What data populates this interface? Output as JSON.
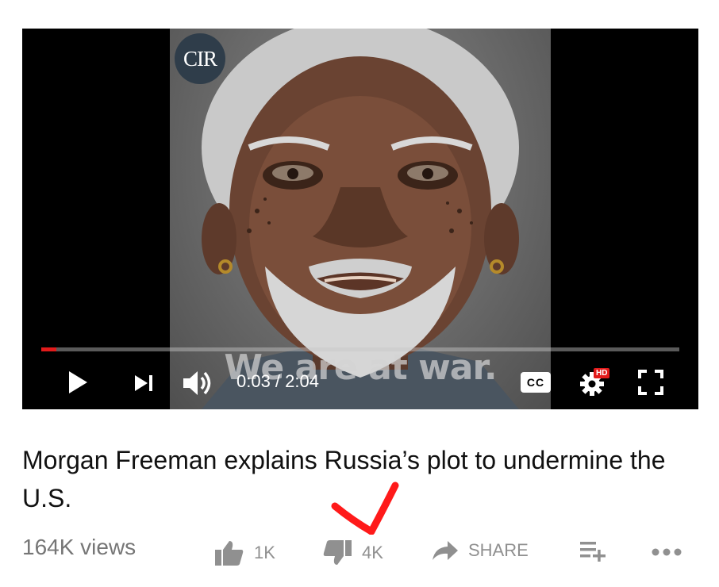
{
  "player": {
    "channel_logo": "CIR",
    "caption_overlay": "We are at war.",
    "current_time": "0:03",
    "duration": "2:04",
    "time_text": "0:03 / 2:04",
    "progress_fraction": 0.024,
    "cc_label": "CC",
    "hd_badge": "HD",
    "colors": {
      "progress": "#e21b1b",
      "hd": "#e21b1b"
    },
    "icons": [
      "play-icon",
      "next-icon",
      "volume-icon",
      "settings-icon",
      "fullscreen-icon"
    ]
  },
  "video": {
    "title": "Morgan Freeman explains Russia’s plot to undermine the U.S.",
    "views": "164K views",
    "likes": "1K",
    "dislikes": "4K",
    "share_label": "SHARE",
    "icons": [
      "thumbs-up-icon",
      "thumbs-down-icon",
      "share-arrow-icon",
      "add-to-playlist-icon",
      "more-icon"
    ]
  },
  "annotation": {
    "color": "#ff1a1a",
    "icon": "red-arrow-pointing-down"
  }
}
